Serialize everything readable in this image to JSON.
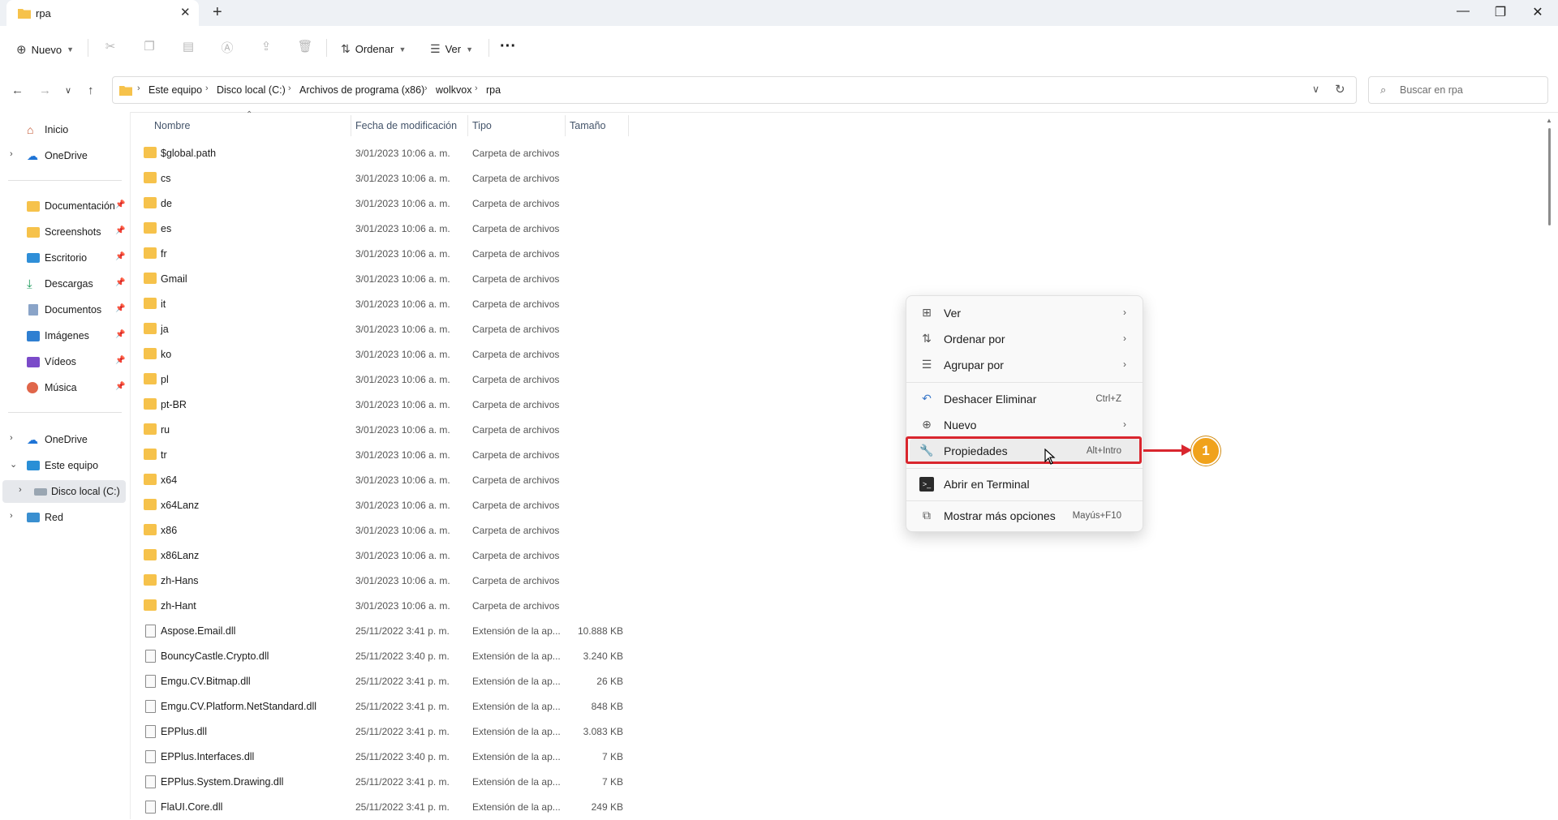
{
  "window": {
    "tab_title": "rpa",
    "tab_close": "✕",
    "new_tab": "+",
    "minimize": "—",
    "maximize": "❐",
    "close": "✕"
  },
  "toolbar": {
    "new_label": "Nuevo",
    "sort_label": "Ordenar",
    "view_label": "Ver",
    "more_label": "···"
  },
  "breadcrumb": [
    "Este equipo",
    "Disco local (C:)",
    "Archivos de programa (x86)",
    "wolkvox",
    "rpa"
  ],
  "search": {
    "placeholder": "Buscar en rpa"
  },
  "sidebar": {
    "home": "Inicio",
    "onedrive_top": "OneDrive",
    "pinned": [
      "Documentación",
      "Screenshots",
      "Escritorio",
      "Descargas",
      "Documentos",
      "Imágenes",
      "Vídeos",
      "Música"
    ],
    "onedrive": "OneDrive",
    "this_pc": "Este equipo",
    "local_disk": "Disco local (C:)",
    "network": "Red"
  },
  "columns": {
    "name": "Nombre",
    "date": "Fecha de modificación",
    "type": "Tipo",
    "size": "Tamaño"
  },
  "files": [
    {
      "name": "$global.path",
      "date": "3/01/2023 10:06 a. m.",
      "type": "Carpeta de archivos",
      "size": "",
      "kind": "folder"
    },
    {
      "name": "cs",
      "date": "3/01/2023 10:06 a. m.",
      "type": "Carpeta de archivos",
      "size": "",
      "kind": "folder"
    },
    {
      "name": "de",
      "date": "3/01/2023 10:06 a. m.",
      "type": "Carpeta de archivos",
      "size": "",
      "kind": "folder"
    },
    {
      "name": "es",
      "date": "3/01/2023 10:06 a. m.",
      "type": "Carpeta de archivos",
      "size": "",
      "kind": "folder"
    },
    {
      "name": "fr",
      "date": "3/01/2023 10:06 a. m.",
      "type": "Carpeta de archivos",
      "size": "",
      "kind": "folder"
    },
    {
      "name": "Gmail",
      "date": "3/01/2023 10:06 a. m.",
      "type": "Carpeta de archivos",
      "size": "",
      "kind": "folder"
    },
    {
      "name": "it",
      "date": "3/01/2023 10:06 a. m.",
      "type": "Carpeta de archivos",
      "size": "",
      "kind": "folder"
    },
    {
      "name": "ja",
      "date": "3/01/2023 10:06 a. m.",
      "type": "Carpeta de archivos",
      "size": "",
      "kind": "folder"
    },
    {
      "name": "ko",
      "date": "3/01/2023 10:06 a. m.",
      "type": "Carpeta de archivos",
      "size": "",
      "kind": "folder"
    },
    {
      "name": "pl",
      "date": "3/01/2023 10:06 a. m.",
      "type": "Carpeta de archivos",
      "size": "",
      "kind": "folder"
    },
    {
      "name": "pt-BR",
      "date": "3/01/2023 10:06 a. m.",
      "type": "Carpeta de archivos",
      "size": "",
      "kind": "folder"
    },
    {
      "name": "ru",
      "date": "3/01/2023 10:06 a. m.",
      "type": "Carpeta de archivos",
      "size": "",
      "kind": "folder"
    },
    {
      "name": "tr",
      "date": "3/01/2023 10:06 a. m.",
      "type": "Carpeta de archivos",
      "size": "",
      "kind": "folder"
    },
    {
      "name": "x64",
      "date": "3/01/2023 10:06 a. m.",
      "type": "Carpeta de archivos",
      "size": "",
      "kind": "folder"
    },
    {
      "name": "x64Lanz",
      "date": "3/01/2023 10:06 a. m.",
      "type": "Carpeta de archivos",
      "size": "",
      "kind": "folder"
    },
    {
      "name": "x86",
      "date": "3/01/2023 10:06 a. m.",
      "type": "Carpeta de archivos",
      "size": "",
      "kind": "folder"
    },
    {
      "name": "x86Lanz",
      "date": "3/01/2023 10:06 a. m.",
      "type": "Carpeta de archivos",
      "size": "",
      "kind": "folder"
    },
    {
      "name": "zh-Hans",
      "date": "3/01/2023 10:06 a. m.",
      "type": "Carpeta de archivos",
      "size": "",
      "kind": "folder"
    },
    {
      "name": "zh-Hant",
      "date": "3/01/2023 10:06 a. m.",
      "type": "Carpeta de archivos",
      "size": "",
      "kind": "folder"
    },
    {
      "name": "Aspose.Email.dll",
      "date": "25/11/2022 3:41 p. m.",
      "type": "Extensión de la ap...",
      "size": "10.888 KB",
      "kind": "file"
    },
    {
      "name": "BouncyCastle.Crypto.dll",
      "date": "25/11/2022 3:40 p. m.",
      "type": "Extensión de la ap...",
      "size": "3.240 KB",
      "kind": "file"
    },
    {
      "name": "Emgu.CV.Bitmap.dll",
      "date": "25/11/2022 3:41 p. m.",
      "type": "Extensión de la ap...",
      "size": "26 KB",
      "kind": "file"
    },
    {
      "name": "Emgu.CV.Platform.NetStandard.dll",
      "date": "25/11/2022 3:41 p. m.",
      "type": "Extensión de la ap...",
      "size": "848 KB",
      "kind": "file"
    },
    {
      "name": "EPPlus.dll",
      "date": "25/11/2022 3:41 p. m.",
      "type": "Extensión de la ap...",
      "size": "3.083 KB",
      "kind": "file"
    },
    {
      "name": "EPPlus.Interfaces.dll",
      "date": "25/11/2022 3:40 p. m.",
      "type": "Extensión de la ap...",
      "size": "7 KB",
      "kind": "file"
    },
    {
      "name": "EPPlus.System.Drawing.dll",
      "date": "25/11/2022 3:41 p. m.",
      "type": "Extensión de la ap...",
      "size": "7 KB",
      "kind": "file"
    },
    {
      "name": "FlaUI.Core.dll",
      "date": "25/11/2022 3:41 p. m.",
      "type": "Extensión de la ap...",
      "size": "249 KB",
      "kind": "file"
    }
  ],
  "context_menu": {
    "view": "Ver",
    "sort_by": "Ordenar por",
    "group_by": "Agrupar por",
    "undo_delete": "Deshacer Eliminar",
    "undo_shortcut": "Ctrl+Z",
    "new": "Nuevo",
    "properties": "Propiedades",
    "properties_shortcut": "Alt+Intro",
    "open_terminal": "Abrir en Terminal",
    "more_options": "Mostrar más opciones",
    "more_options_shortcut": "Mayús+F10"
  },
  "annotation": {
    "callout_number": "1"
  },
  "colors": {
    "accent_folder": "#f6c24b",
    "highlight": "#d9262e",
    "callout": "#f0a21b"
  }
}
